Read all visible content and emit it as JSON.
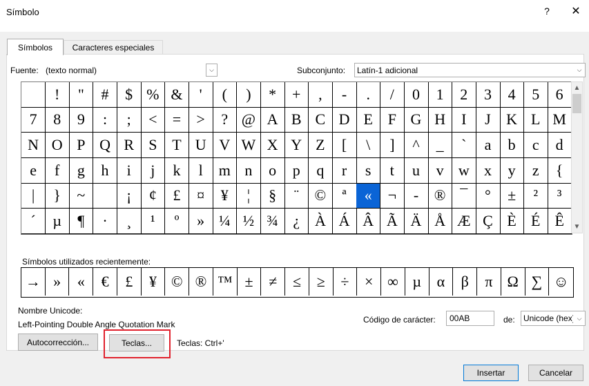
{
  "window": {
    "title": "Símbolo",
    "help": "?",
    "close": "✕"
  },
  "tabs": {
    "simbolos": "Símbolos",
    "especiales": "Caracteres especiales"
  },
  "font": {
    "label": "Fuente:",
    "value": "(texto normal)"
  },
  "subset": {
    "label": "Subconjunto:",
    "value": "Latín-1 adicional"
  },
  "grid": {
    "rows": [
      [
        " ",
        "!",
        "\"",
        "#",
        "$",
        "%",
        "&",
        "'",
        "(",
        ")",
        "*",
        "+",
        ",",
        "-",
        ".",
        "/",
        "0",
        "1",
        "2",
        "3",
        "4",
        "5",
        "6"
      ],
      [
        "7",
        "8",
        "9",
        ":",
        ";",
        "<",
        "=",
        ">",
        "?",
        "@",
        "A",
        "B",
        "C",
        "D",
        "E",
        "F",
        "G",
        "H",
        "I",
        "J",
        "K",
        "L",
        "M"
      ],
      [
        "N",
        "O",
        "P",
        "Q",
        "R",
        "S",
        "T",
        "U",
        "V",
        "W",
        "X",
        "Y",
        "Z",
        "[",
        "\\",
        "]",
        "^",
        "_",
        "`",
        "a",
        "b",
        "c",
        "d"
      ],
      [
        "e",
        "f",
        "g",
        "h",
        "i",
        "j",
        "k",
        "l",
        "m",
        "n",
        "o",
        "p",
        "q",
        "r",
        "s",
        "t",
        "u",
        "v",
        "w",
        "x",
        "y",
        "z",
        "{"
      ],
      [
        "|",
        "}",
        "~",
        " ",
        "¡",
        "¢",
        "£",
        "¤",
        "¥",
        "¦",
        "§",
        "¨",
        "©",
        "ª",
        "«",
        "¬",
        "-",
        "®",
        "¯",
        "°",
        "±",
        "²",
        "³"
      ],
      [
        "´",
        "µ",
        "¶",
        "·",
        "¸",
        "¹",
        "º",
        "»",
        "¼",
        "½",
        "¾",
        "¿",
        "À",
        "Á",
        "Â",
        "Ã",
        "Ä",
        "Å",
        "Æ",
        "Ç",
        "È",
        "É",
        "Ê"
      ]
    ],
    "selected": {
      "row": 4,
      "col": 14
    }
  },
  "recent": {
    "label": "Símbolos utilizados recientemente:",
    "items": [
      "→",
      "»",
      "«",
      "€",
      "£",
      "¥",
      "©",
      "®",
      "™",
      "±",
      "≠",
      "≤",
      "≥",
      "÷",
      "×",
      "∞",
      "µ",
      "α",
      "β",
      "π",
      "Ω",
      "∑",
      "☺"
    ]
  },
  "unicode": {
    "label": "Nombre Unicode:",
    "value": "Left-Pointing Double Angle Quotation Mark"
  },
  "code": {
    "label": "Código de carácter:",
    "value": "00AB",
    "de_label": "de:",
    "de_value": "Unicode (hex)"
  },
  "buttons": {
    "autocorrect": "Autocorrección...",
    "keys": "Teclas...",
    "shortcut": "Teclas: Ctrl+'",
    "insert": "Insertar",
    "cancel": "Cancelar"
  },
  "colors": {
    "selection": "#0a64d6",
    "highlight_box": "#e0202c",
    "default_button_border": "#0078d7"
  }
}
